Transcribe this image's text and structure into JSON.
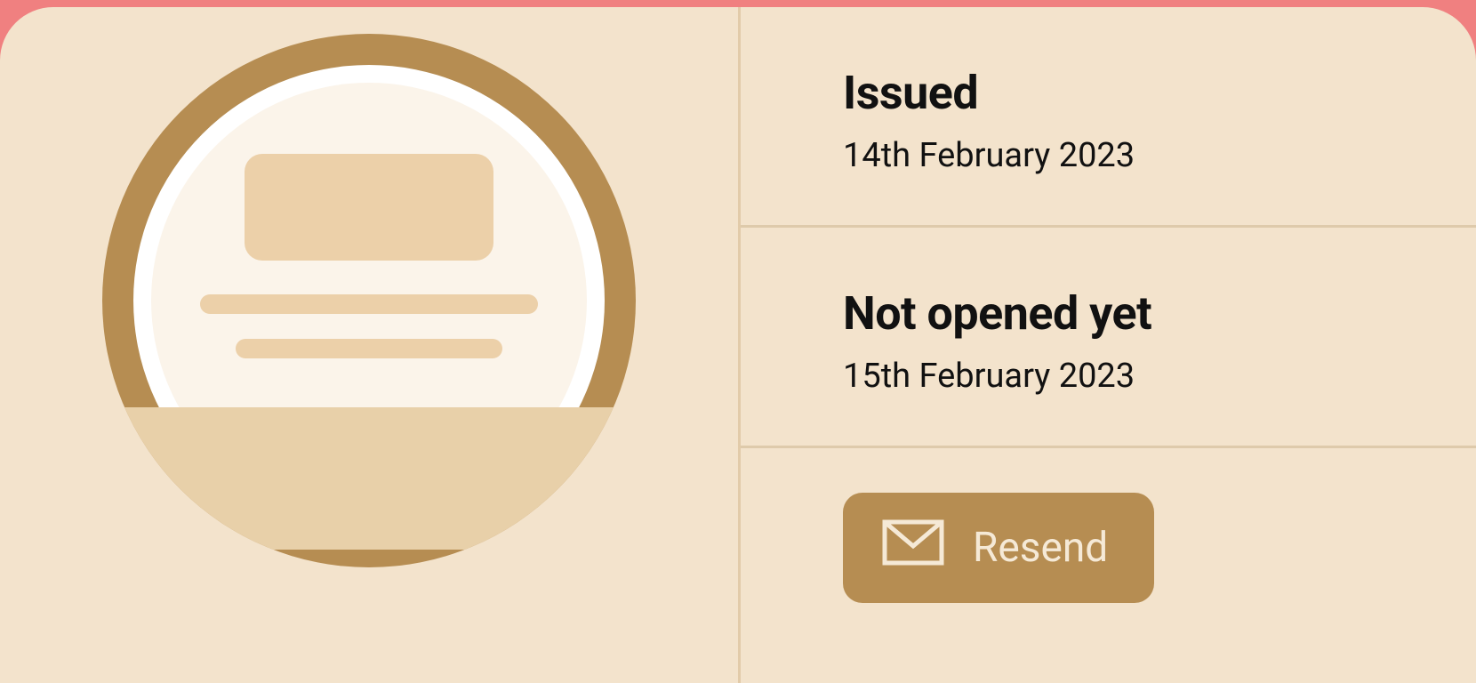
{
  "status": {
    "issued": {
      "title": "Issued",
      "date": "14th February 2023"
    },
    "opened": {
      "title": "Not opened yet",
      "date": "15th February 2023"
    }
  },
  "actions": {
    "resend_label": "Resend"
  }
}
